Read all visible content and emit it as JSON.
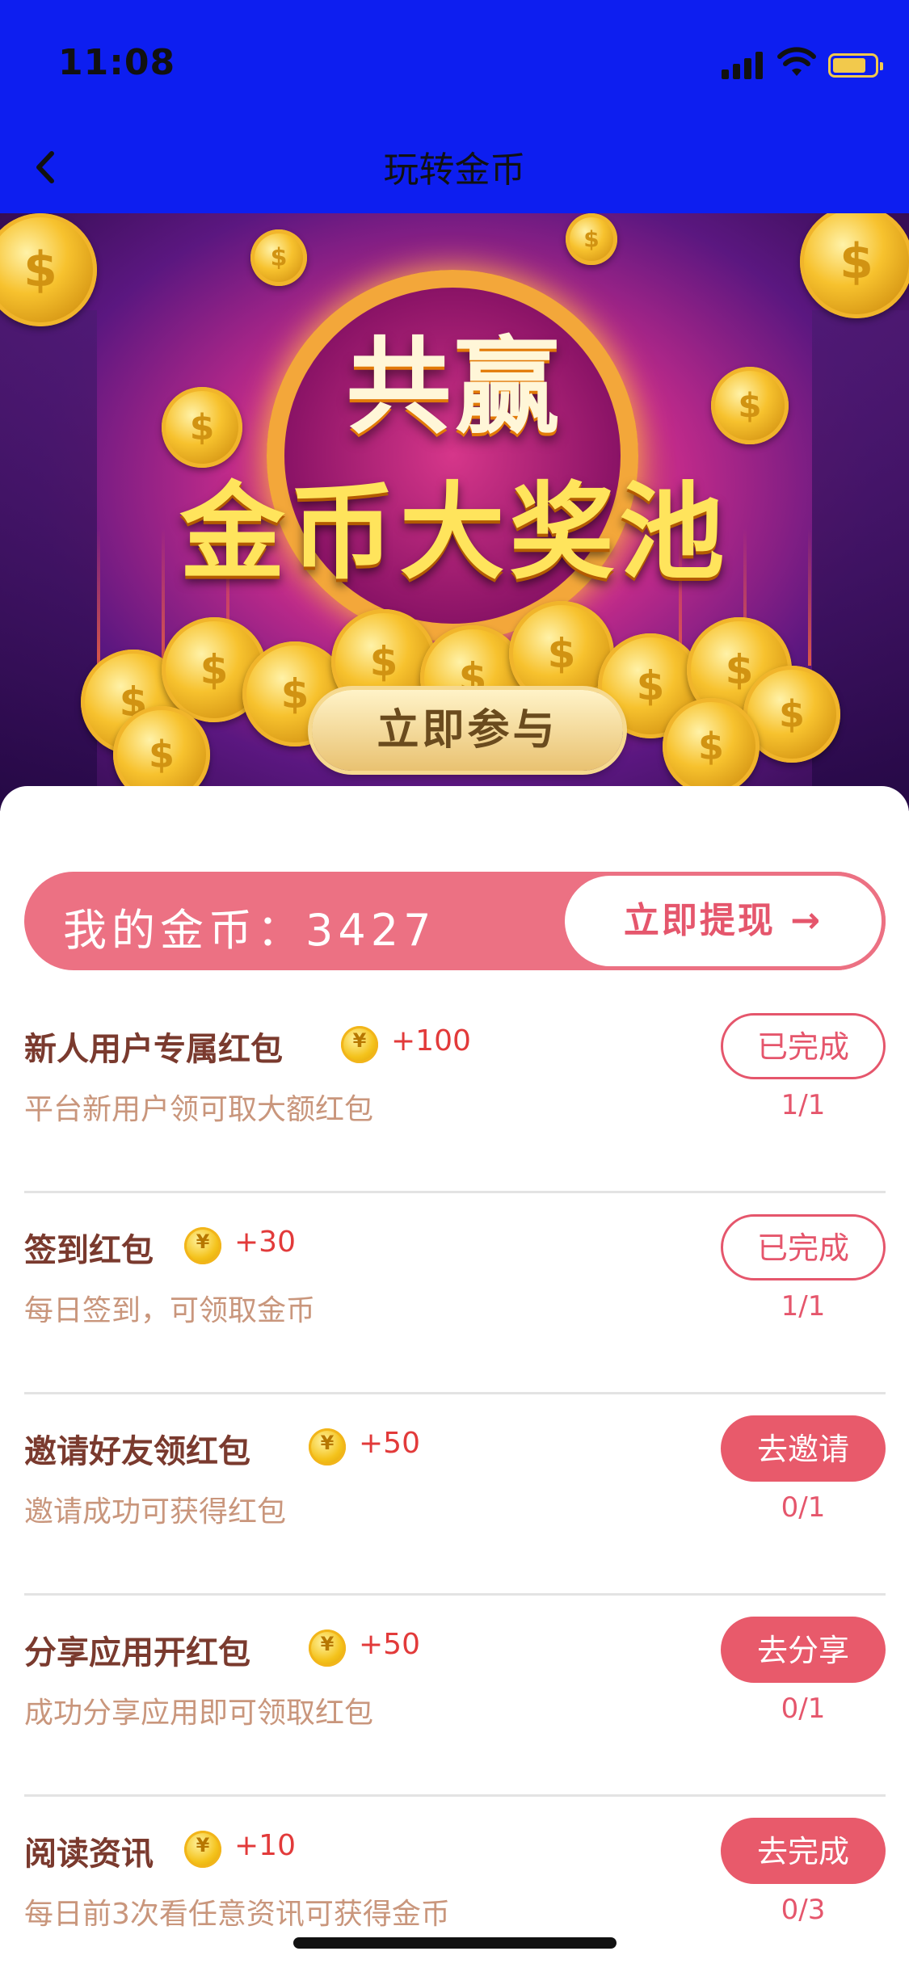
{
  "status_bar": {
    "time": "11:08"
  },
  "nav": {
    "title": "玩转金币"
  },
  "banner": {
    "headline_top": "共赢",
    "headline_main": "金币大奖池",
    "join_label": "立即参与"
  },
  "coins": {
    "label": "我的金币：3427",
    "withdraw_label": "立即提现 →"
  },
  "tasks": [
    {
      "title": "新人用户专属红包",
      "reward": "+100",
      "desc": "平台新用户领可取大额红包",
      "button": "已完成",
      "button_state": "done",
      "progress": "1/1"
    },
    {
      "title": "签到红包",
      "reward": "+30",
      "desc": "每日签到，可领取金币",
      "button": "已完成",
      "button_state": "done",
      "progress": "1/1"
    },
    {
      "title": "邀请好友领红包",
      "reward": "+50",
      "desc": "邀请成功可获得红包",
      "button": "去邀请",
      "button_state": "todo",
      "progress": "0/1"
    },
    {
      "title": "分享应用开红包",
      "reward": "+50",
      "desc": "成功分享应用即可领取红包",
      "button": "去分享",
      "button_state": "todo",
      "progress": "0/1"
    },
    {
      "title": "阅读资讯",
      "reward": "+10",
      "desc": "每日前3次看任意资讯可获得金币",
      "button": "去完成",
      "button_state": "todo",
      "progress": "0/3"
    }
  ],
  "colors": {
    "nav_bg": "#0d1ef0",
    "accent": "#e85a6b",
    "coins_bar": "#ec7183",
    "title_text": "#7a3a2e",
    "desc_text": "#c9967c",
    "reward_text": "#e23a3a"
  },
  "icons": [
    "back-chevron-icon",
    "signal-icon",
    "wifi-icon",
    "battery-icon",
    "coin-icon"
  ]
}
